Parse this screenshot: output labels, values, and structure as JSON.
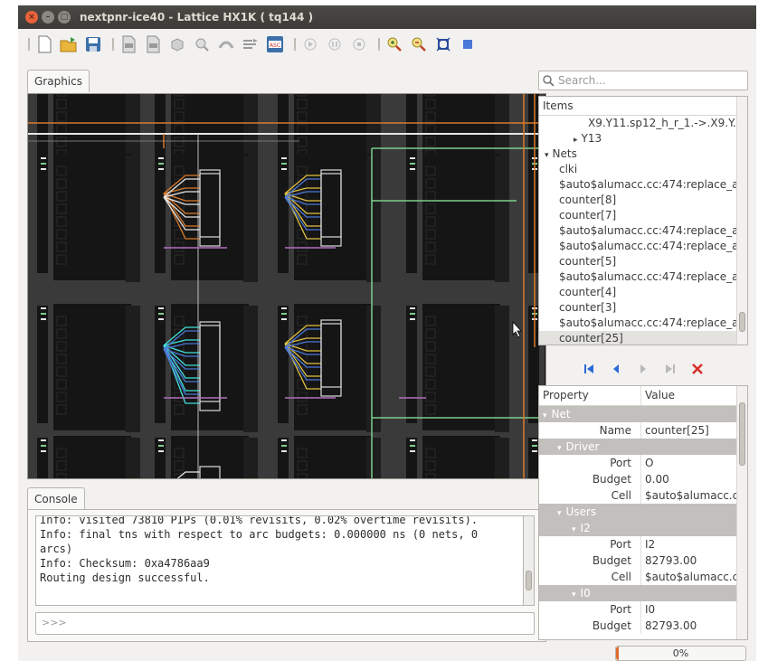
{
  "window": {
    "title": "nextpnr-ice40 - Lattice HX1K ( tq144 )"
  },
  "toolbar": {
    "buttons": [
      "new-icon",
      "open-icon",
      "save-icon",
      "load-json-icon",
      "load-pcf-icon",
      "pack-icon",
      "place-icon",
      "route-icon",
      "assign-budget-icon",
      "save-asc-icon",
      "play-icon",
      "pause-icon",
      "stop-icon",
      "zoom-in-icon",
      "zoom-out-icon",
      "zoom-fit-icon",
      "zoom-outbound-icon"
    ],
    "asc_label": "ASC"
  },
  "graphics_tab": {
    "label": "Graphics"
  },
  "console_tab": {
    "label": "Console"
  },
  "console": {
    "lines": [
      "Info: visited 73810 PIPs (0.01% revisits, 0.02% overtime revisits).",
      "Info: final tns with respect to arc budgets: 0.000000 ns (0 nets, 0",
      "arcs)",
      "Info: Checksum: 0xa4786aa9",
      "Routing design successful."
    ],
    "input_placeholder": ">>>"
  },
  "search": {
    "placeholder": "Search..."
  },
  "items_tree": {
    "header": "Items",
    "rows": [
      {
        "label": "X9.Y11.sp12_h_r_1.->.X9.Y...",
        "indent": 3,
        "arrow": ""
      },
      {
        "label": "Y13",
        "indent": 2,
        "arrow": "▸"
      },
      {
        "label": "Nets",
        "indent": 0,
        "arrow": "▾"
      },
      {
        "label": "clki",
        "indent": 1,
        "arrow": ""
      },
      {
        "label": "$auto$alumacc.cc:474:replace_al...",
        "indent": 1,
        "arrow": ""
      },
      {
        "label": "counter[8]",
        "indent": 1,
        "arrow": ""
      },
      {
        "label": "counter[7]",
        "indent": 1,
        "arrow": ""
      },
      {
        "label": "$auto$alumacc.cc:474:replace_al...",
        "indent": 1,
        "arrow": ""
      },
      {
        "label": "$auto$alumacc.cc:474:replace_al...",
        "indent": 1,
        "arrow": ""
      },
      {
        "label": "counter[5]",
        "indent": 1,
        "arrow": ""
      },
      {
        "label": "$auto$alumacc.cc:474:replace_al...",
        "indent": 1,
        "arrow": ""
      },
      {
        "label": "counter[4]",
        "indent": 1,
        "arrow": ""
      },
      {
        "label": "counter[3]",
        "indent": 1,
        "arrow": ""
      },
      {
        "label": "$auto$alumacc.cc:474:replace_al...",
        "indent": 1,
        "arrow": ""
      },
      {
        "label": "counter[25]",
        "indent": 1,
        "arrow": "",
        "selected": true
      }
    ]
  },
  "nav": [
    "first-icon",
    "back-icon",
    "forward-icon",
    "last-icon",
    "clear-icon"
  ],
  "properties": {
    "col_property": "Property",
    "col_value": "Value",
    "rows": [
      {
        "name": "Net",
        "value": "",
        "group": true,
        "level": 0
      },
      {
        "name": "Name",
        "value": "counter[25]",
        "level": 2
      },
      {
        "name": "Driver",
        "value": "",
        "group": true,
        "level": 1
      },
      {
        "name": "Port",
        "value": "O",
        "level": 2
      },
      {
        "name": "Budget",
        "value": "0.00",
        "level": 2
      },
      {
        "name": "Cell",
        "value": "$auto$alumacc.cc...",
        "level": 2
      },
      {
        "name": "Users",
        "value": "",
        "group": true,
        "level": 1
      },
      {
        "name": "I2",
        "value": "",
        "group": true,
        "level": 2
      },
      {
        "name": "Port",
        "value": "I2",
        "level": 3
      },
      {
        "name": "Budget",
        "value": "82793.00",
        "level": 3
      },
      {
        "name": "Cell",
        "value": "$auto$alumacc.cc...",
        "level": 3
      },
      {
        "name": "I0",
        "value": "",
        "group": true,
        "level": 2
      },
      {
        "name": "Port",
        "value": "I0",
        "level": 3
      },
      {
        "name": "Budget",
        "value": "82793.00",
        "level": 3
      }
    ]
  },
  "status": {
    "progress": "0%",
    "progress_fraction": 0.0
  },
  "colors": {
    "titlebar": "#3c3b37",
    "canvas_bg": "#3a3a3a",
    "tile": "#151515",
    "white_wire": "#e6e6e6",
    "orange_wire": "#d97a2b",
    "green_wire": "#7ccf8a",
    "cyan_wire": "#42e0d8",
    "yellow_wire": "#e0c040",
    "purple_wire": "#b070c0",
    "blue_wire": "#4a78d8"
  }
}
